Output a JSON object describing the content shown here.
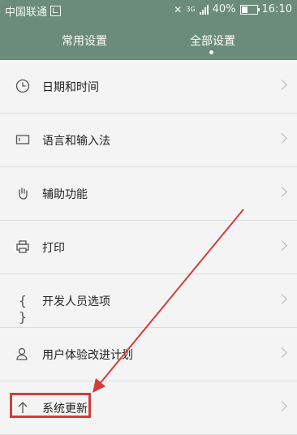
{
  "status_bar": {
    "carrier": "中国联通",
    "network": "3G",
    "battery": "40%",
    "time": "16:10"
  },
  "tabs": [
    {
      "label": "常用设置",
      "active": false
    },
    {
      "label": "全部设置",
      "active": true
    }
  ],
  "settings": [
    {
      "label": "日期和时间",
      "icon": "clock-icon"
    },
    {
      "label": "语言和输入法",
      "icon": "keyboard-icon"
    },
    {
      "label": "辅助功能",
      "icon": "hand-icon"
    },
    {
      "label": "打印",
      "icon": "printer-icon"
    },
    {
      "label": "开发人员选项",
      "icon": "braces-icon"
    },
    {
      "label": "用户体验改进计划",
      "icon": "user-icon"
    },
    {
      "label": "系统更新",
      "icon": "arrow-up-icon"
    }
  ],
  "colors": {
    "header": "#6b8c7a",
    "annotation": "#d43c3c"
  }
}
